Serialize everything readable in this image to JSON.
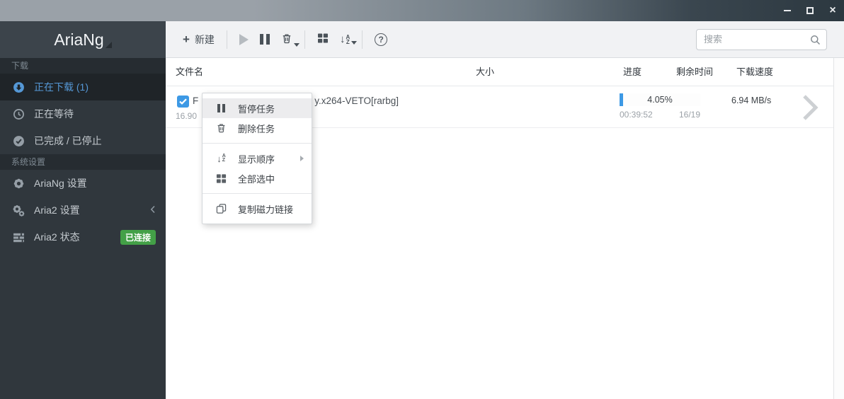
{
  "titlebar": {
    "window_controls": {
      "close_glyph": "×"
    }
  },
  "sidebar": {
    "logo": "AriaNg",
    "sections": [
      {
        "label": "下载",
        "items": [
          {
            "label": "正在下载 (1)",
            "icon": "arrow-circle-down-icon",
            "active": true
          },
          {
            "label": "正在等待",
            "icon": "clock-icon"
          },
          {
            "label": "已完成 / 已停止",
            "icon": "check-circle-icon"
          }
        ]
      },
      {
        "label": "系统设置",
        "items": [
          {
            "label": "AriaNg 设置",
            "icon": "gear-icon"
          },
          {
            "label": "Aria2 设置",
            "icon": "gears-icon",
            "has_submenu": true
          },
          {
            "label": "Aria2 状态",
            "icon": "tasks-icon",
            "badge": "已连接"
          }
        ]
      }
    ]
  },
  "toolbar": {
    "new_label": "新建",
    "plus_glyph": "+",
    "sort_arrow_glyph": "↓",
    "sort_letters": [
      "A",
      "Z"
    ],
    "help_glyph": "?",
    "search_placeholder": "搜索"
  },
  "table": {
    "headers": [
      "文件名",
      "大小",
      "进度",
      "剩余时间",
      "下载速度"
    ]
  },
  "task": {
    "selected": true,
    "filename_visible_start": "F",
    "filename_visible_end": "y.x264-VETO[rarbg]",
    "size_visible": "16.90",
    "progress_percent": "4.05%",
    "progress_value": 4.05,
    "remaining_time": "00:39:52",
    "connections": "16/19",
    "download_speed": "6.94 MB/s"
  },
  "context_menu": {
    "items": [
      {
        "label": "暂停任务",
        "icon": "pause-icon",
        "highlighted": true
      },
      {
        "label": "删除任务",
        "icon": "trash-icon"
      },
      {
        "label": "显示顺序",
        "icon": "sort-icon",
        "has_submenu": true
      },
      {
        "label": "全部选中",
        "icon": "grid-icon"
      },
      {
        "label": "复制磁力链接",
        "icon": "copy-icon"
      }
    ]
  },
  "colors": {
    "accent": "#3d99e5",
    "active_blue": "#5598d6",
    "badge_green": "#43a047",
    "titlebar_left": "#9aa1a8",
    "titlebar_right": "#2c3840",
    "sidebar_bg": "#30373d",
    "sidebar_header_bg": "#3c444b",
    "sidebar_section_bg": "#262c31",
    "sidebar_active_bg": "#1f2428",
    "toolbar_bg": "#f1f2f4"
  }
}
